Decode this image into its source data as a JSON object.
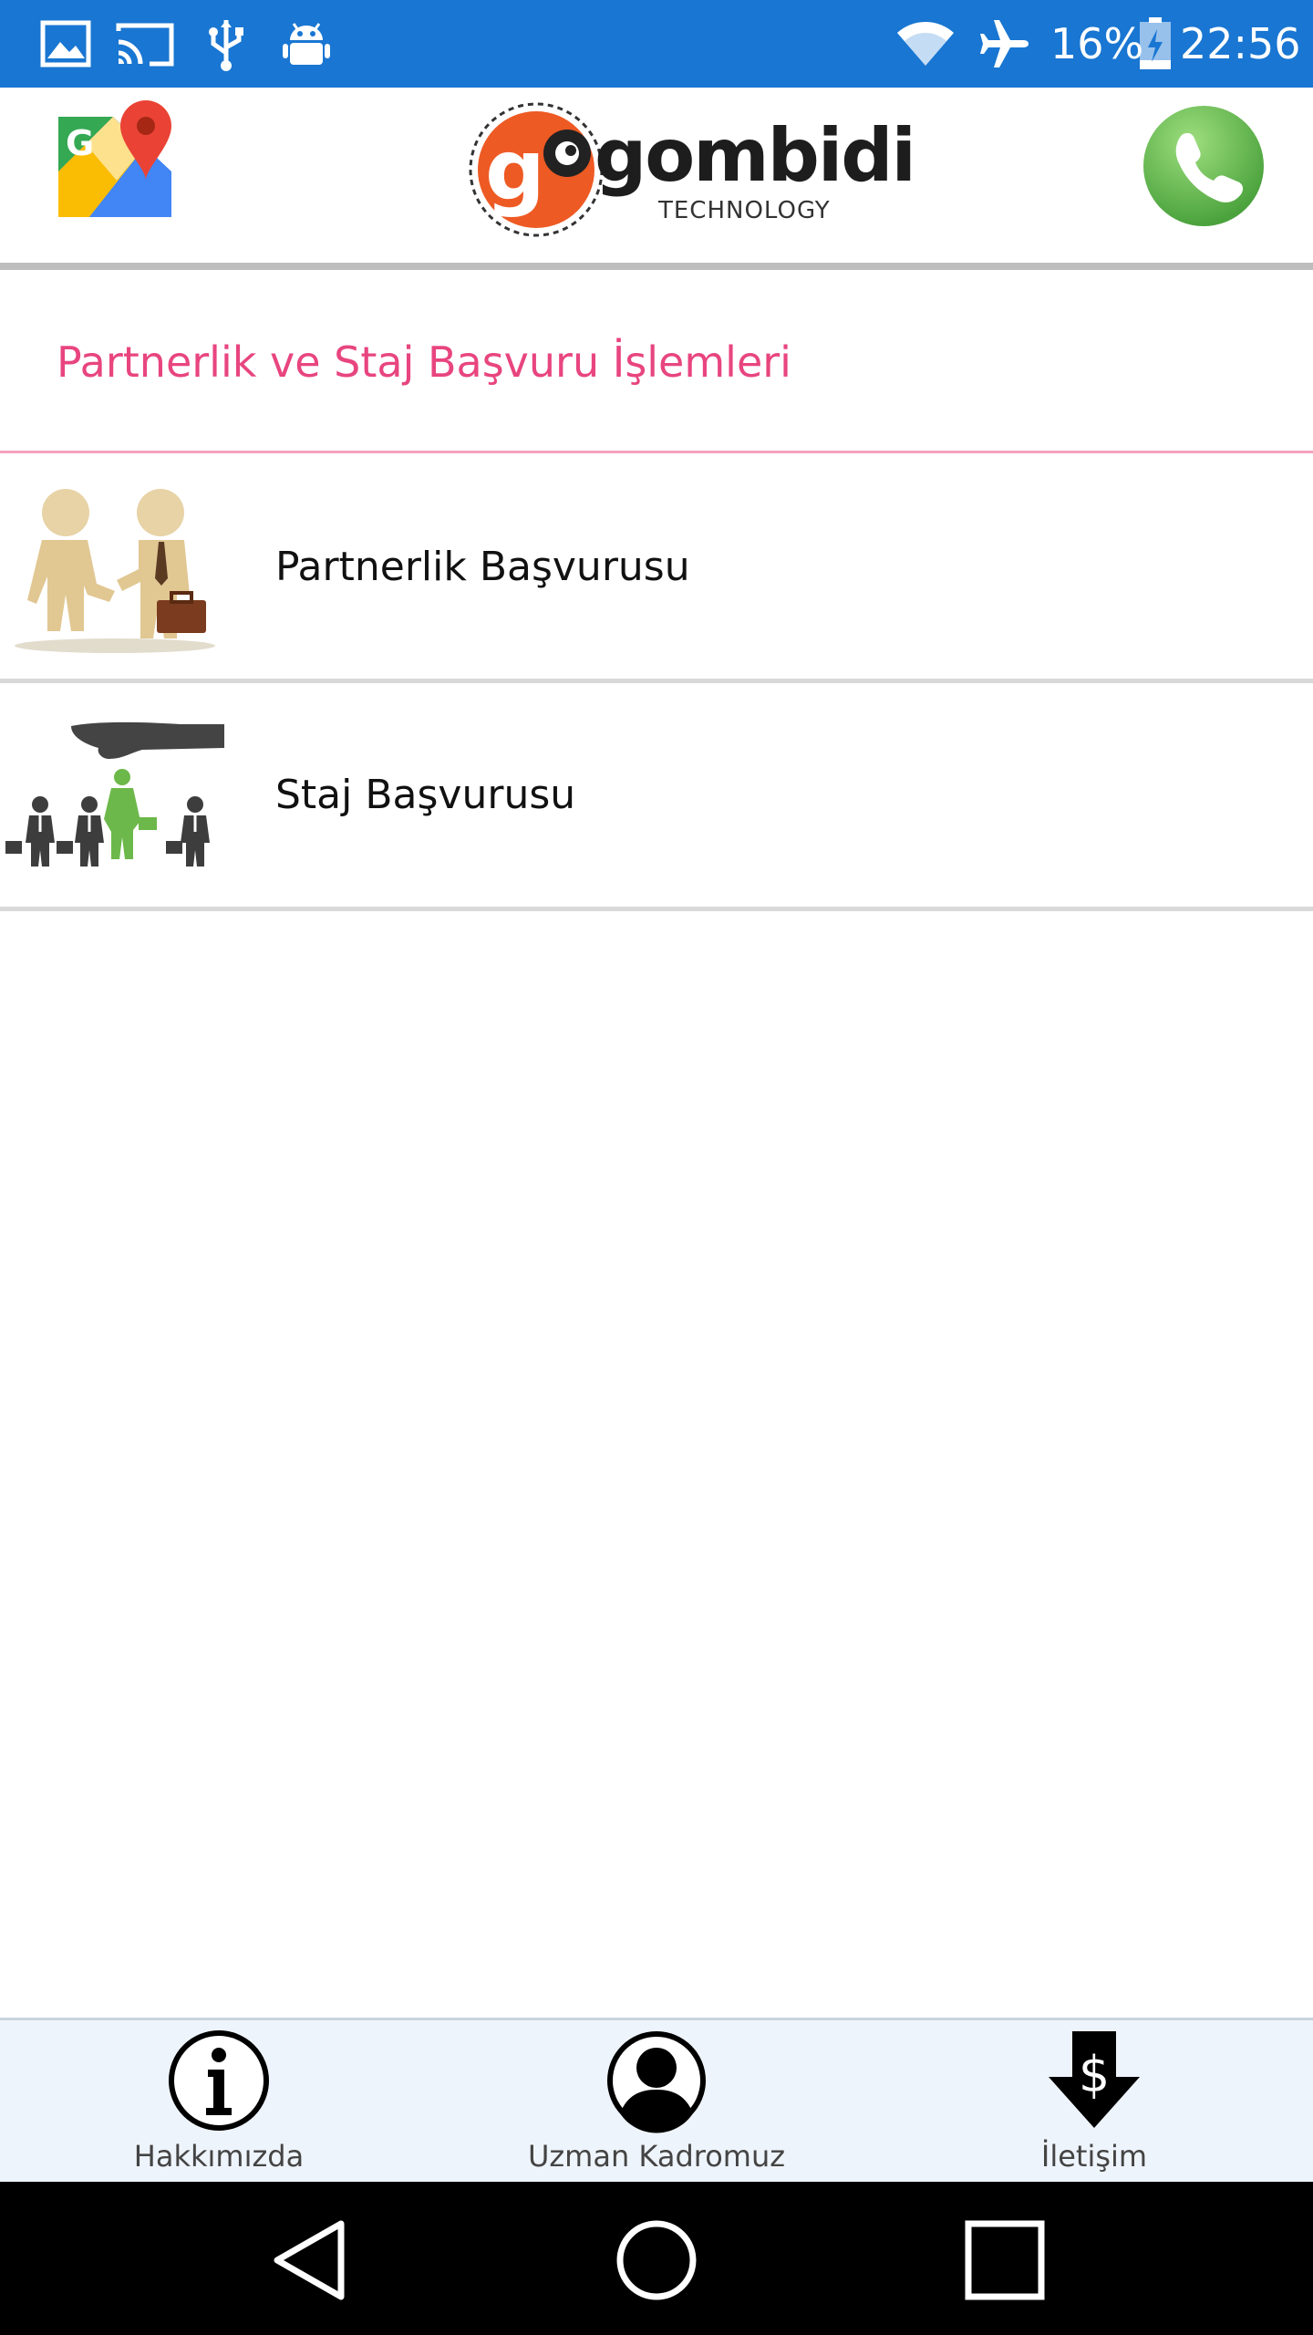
{
  "status_bar": {
    "battery": "16%",
    "time": "22:56",
    "icons": [
      "image-icon",
      "cast-icon",
      "usb-icon",
      "android-debug-icon",
      "wifi-icon",
      "airplane-mode-icon",
      "battery-charging-icon"
    ]
  },
  "app_bar": {
    "logo_text": "gombidi",
    "logo_sub": "TECHNOLOGY",
    "left_icon": "google-maps-icon",
    "right_icon": "phone-call-icon"
  },
  "section": {
    "title": "Partnerlik ve Staj Başvuru İşlemleri"
  },
  "items": [
    {
      "label": "Partnerlik Başvurusu",
      "icon": "handshake-icon"
    },
    {
      "label": "Staj Başvurusu",
      "icon": "recruitment-icon"
    }
  ],
  "bottom_nav": {
    "items": [
      {
        "label": "Hakkımızda",
        "icon": "info-icon"
      },
      {
        "label": "Uzman Kadromuz",
        "icon": "person-icon"
      },
      {
        "label": "İletişim",
        "icon": "dollar-down-arrow-icon"
      }
    ]
  },
  "colors": {
    "status_bar": "#1976d2",
    "accent_pink": "#e8457f",
    "logo_orange": "#ee5a24",
    "phone_green": "#5cb54c"
  }
}
